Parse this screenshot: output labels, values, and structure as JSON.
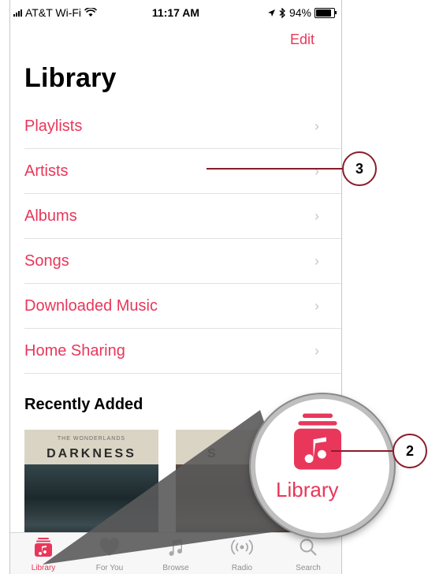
{
  "status": {
    "carrier": "AT&T Wi-Fi",
    "time": "11:17 AM",
    "battery": "94%"
  },
  "header": {
    "edit_label": "Edit",
    "title": "Library"
  },
  "menu": [
    {
      "label": "Playlists"
    },
    {
      "label": "Artists"
    },
    {
      "label": "Albums"
    },
    {
      "label": "Songs"
    },
    {
      "label": "Downloaded Music"
    },
    {
      "label": "Home Sharing"
    }
  ],
  "recent": {
    "title": "Recently Added",
    "albums": [
      {
        "subtitle": "THE WONDERLANDS",
        "name": "DARKNESS"
      },
      {
        "subtitle": "",
        "name": "S"
      }
    ]
  },
  "tabs": [
    {
      "label": "Library",
      "icon": "library-icon",
      "active": true
    },
    {
      "label": "For You",
      "icon": "heart-icon"
    },
    {
      "label": "Browse",
      "icon": "music-note-icon"
    },
    {
      "label": "Radio",
      "icon": "radio-icon"
    },
    {
      "label": "Search",
      "icon": "search-icon"
    }
  ],
  "magnifier": {
    "label": "Library"
  },
  "callouts": {
    "c2": "2",
    "c3": "3"
  },
  "colors": {
    "accent": "#e8375a",
    "callout": "#8a1b2c"
  }
}
